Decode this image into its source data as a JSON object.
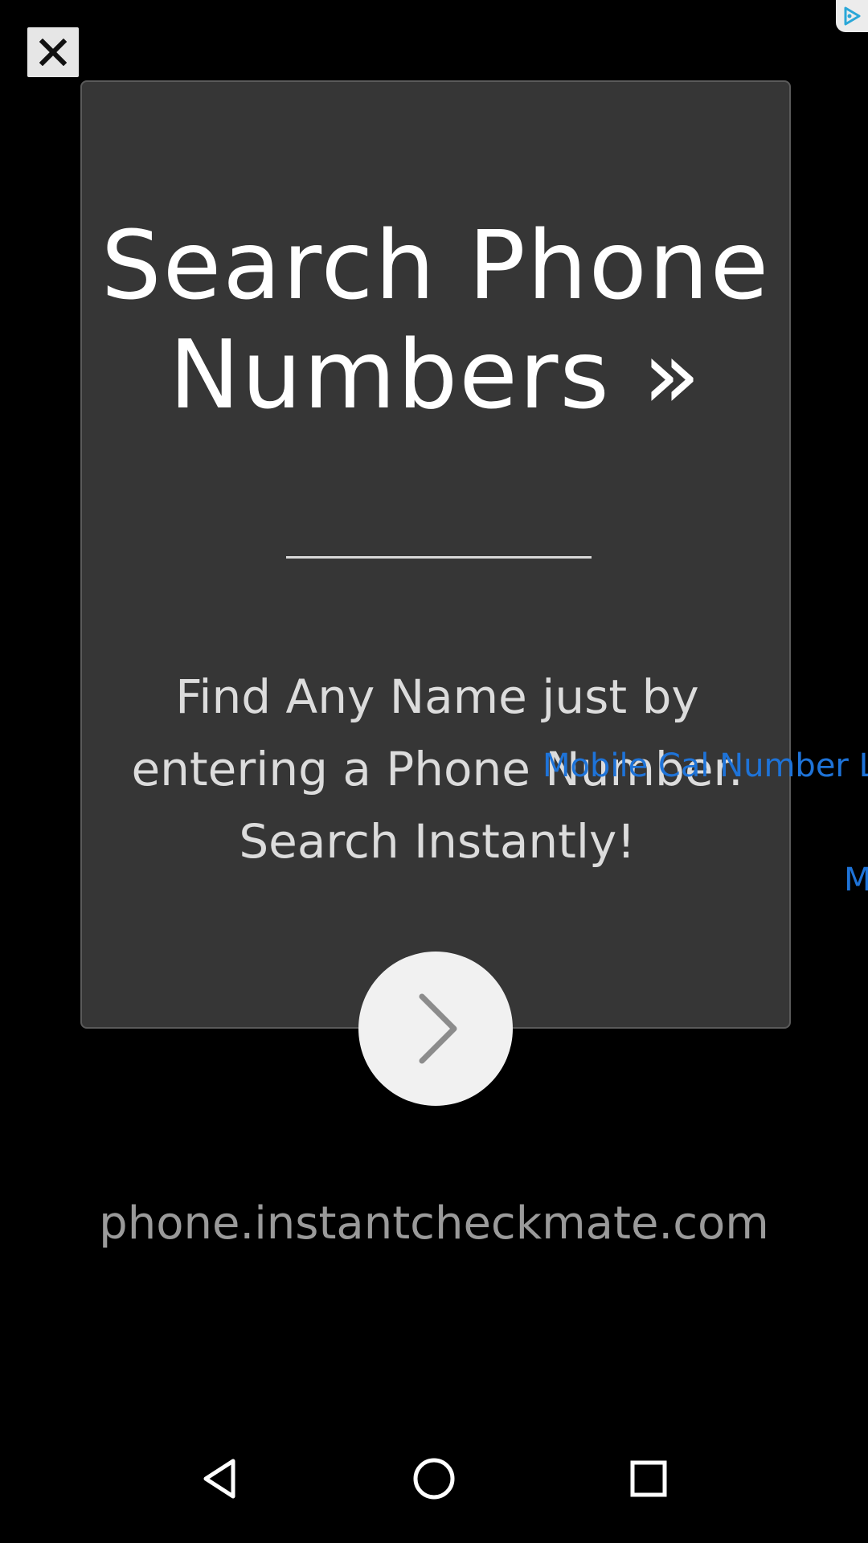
{
  "colors": {
    "background": "#000000",
    "card": "#363636",
    "link_blue": "#1e73d8",
    "headline": "#ffffff",
    "domain_text": "#9a9a9a"
  },
  "ad": {
    "close_icon": "close-icon",
    "adchoices_icon": "adchoices-icon",
    "headline": "Search Phone Numbers »",
    "divider": "____________",
    "body": "Find Any Name just by entering a Phone Number. Search Instantly!",
    "next_icon": "chevron-right-icon",
    "domain": "phone.instantcheckmate.com"
  },
  "overlay": {
    "link_1": "Mobile Cal Number L",
    "link_2": "M"
  },
  "navbar": {
    "back_icon": "back-triangle-icon",
    "home_icon": "home-circle-icon",
    "recents_icon": "recents-square-icon"
  }
}
